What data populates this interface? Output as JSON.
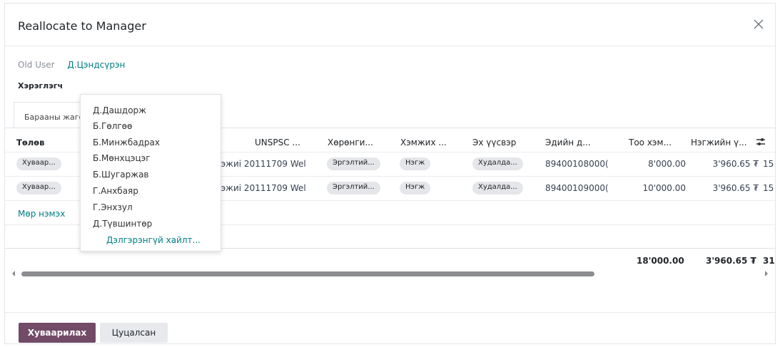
{
  "dialog": {
    "title": "Reallocate to Manager",
    "close_icon": "close-icon"
  },
  "form": {
    "old_user_label": "Old User",
    "old_user_value": "Д.Цэндсүрэн",
    "user_label": "Хэрэглэгч"
  },
  "tabs": [
    {
      "label": "Барааны жагсаалт"
    }
  ],
  "table": {
    "columns": [
      "Төлөв",
      "UNSPSC ...",
      "Хөрөнги...",
      "Хэмжих ...",
      "Эх үүсвэр",
      "Эдийн д...",
      "Тоо хэм...",
      "Нэгжийн ү..."
    ],
    "rows": [
      {
        "status": "Хуваар...",
        "description": "ээжиі 20111709 Wel",
        "asset": "Эргэлтий...",
        "uom": "Нэгж",
        "source": "Худалда...",
        "item_code": "89400108000(",
        "qty": "8'000.00",
        "unit_price": "3'960.65 ₮",
        "overflow": "15"
      },
      {
        "status": "Хуваар...",
        "description": "ээжиі 20111709 Wel",
        "asset": "Эргэлтий...",
        "uom": "Нэгж",
        "source": "Худалда...",
        "item_code": "89400109000(",
        "qty": "10'000.00",
        "unit_price": "3'960.65 ₮",
        "overflow": "15"
      }
    ],
    "add_line": "Мөр нэмэх",
    "totals": {
      "qty": "18'000.00",
      "unit_price": "3'960.65 ₮",
      "overflow": "31"
    }
  },
  "dropdown": {
    "options": [
      "Д.Дашдорж",
      "Б.Гөлгөө",
      "Б.Минжбадрах",
      "Б.Мөнхцэцэг",
      "Б.Шугаржав",
      "Г.Анхбаяр",
      "Г.Энхзул",
      "Д.Түвшинтөр"
    ],
    "more_label": "Дэлгэрэнгүй хайлт..."
  },
  "footer": {
    "primary_label": "Хуваарилах",
    "cancel_label": "Цуцалсан"
  },
  "colors": {
    "primary": "#714b67",
    "link": "#017e84",
    "pill": "#e4e6ea"
  }
}
